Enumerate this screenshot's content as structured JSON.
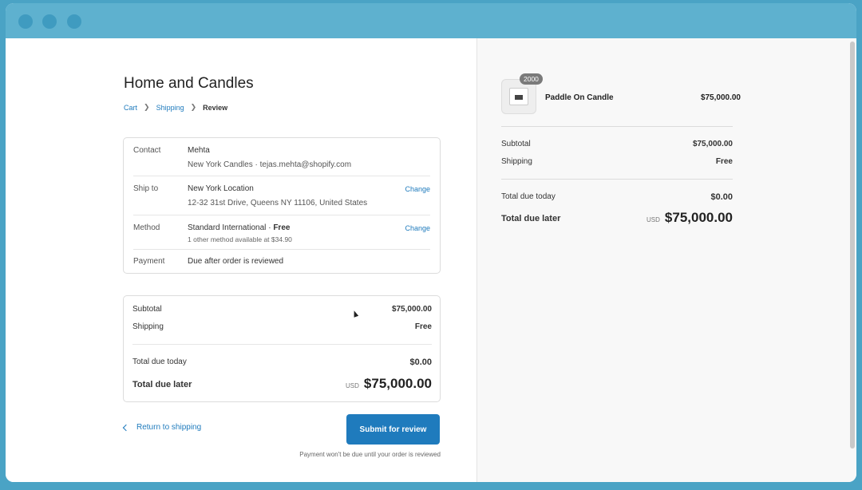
{
  "store": {
    "title": "Home and Candles"
  },
  "breadcrumb": {
    "cart": "Cart",
    "shipping": "Shipping",
    "review": "Review"
  },
  "review": {
    "contact": {
      "label": "Contact",
      "name": "Mehta",
      "detail": "New York Candles · tejas.mehta@shopify.com"
    },
    "ship_to": {
      "label": "Ship to",
      "location": "New York Location",
      "address": "12-32 31st Drive, Queens NY 11106, United States",
      "change": "Change"
    },
    "method": {
      "label": "Method",
      "name": "Standard International",
      "separator": "·",
      "price": "Free",
      "note": "1 other method available at $34.90",
      "change": "Change"
    },
    "payment": {
      "label": "Payment",
      "value": "Due after order is reviewed"
    }
  },
  "totals": {
    "subtotal_label": "Subtotal",
    "subtotal_value": "$75,000.00",
    "shipping_label": "Shipping",
    "shipping_value": "Free",
    "due_today_label": "Total due today",
    "due_today_value": "$0.00",
    "due_later_label": "Total due later",
    "currency": "USD",
    "due_later_value": "$75,000.00"
  },
  "actions": {
    "return_label": "Return to shipping",
    "submit_label": "Submit for review",
    "note": "Payment won't be due until your order is reviewed"
  },
  "sidebar": {
    "product": {
      "name": "Paddle On Candle",
      "price": "$75,000.00",
      "quantity": "2000"
    }
  }
}
